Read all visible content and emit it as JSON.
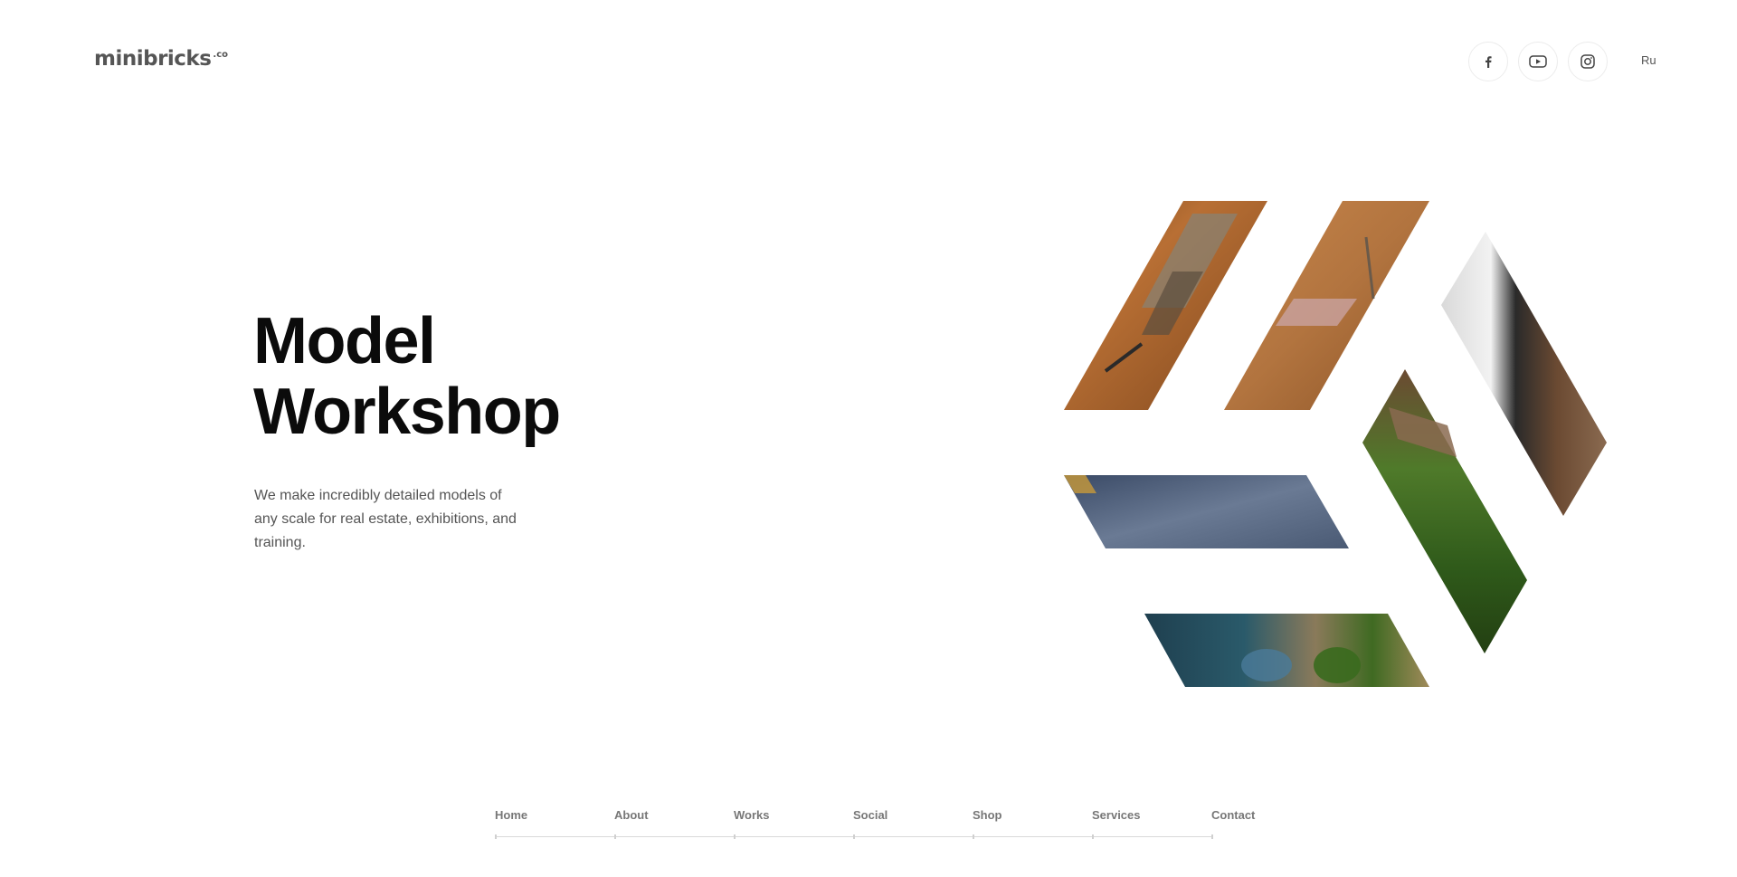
{
  "header": {
    "logo_main": "minibricks",
    "logo_suffix": ".co",
    "social": [
      "facebook-icon",
      "youtube-icon",
      "instagram-icon"
    ],
    "language": "Ru"
  },
  "hero": {
    "title_line1": "Model",
    "title_line2": "Workshop",
    "description": "We make incredibly detailed models of any scale for real estate, exhibitions, and training."
  },
  "nav": {
    "items": [
      "Home",
      "About",
      "Works",
      "Social",
      "Shop",
      "Services",
      "Contact"
    ]
  },
  "colors": {
    "text_dark": "#0b0b0b",
    "text_muted": "#555555",
    "nav_text": "#777777",
    "divider": "#d9d9d9"
  }
}
